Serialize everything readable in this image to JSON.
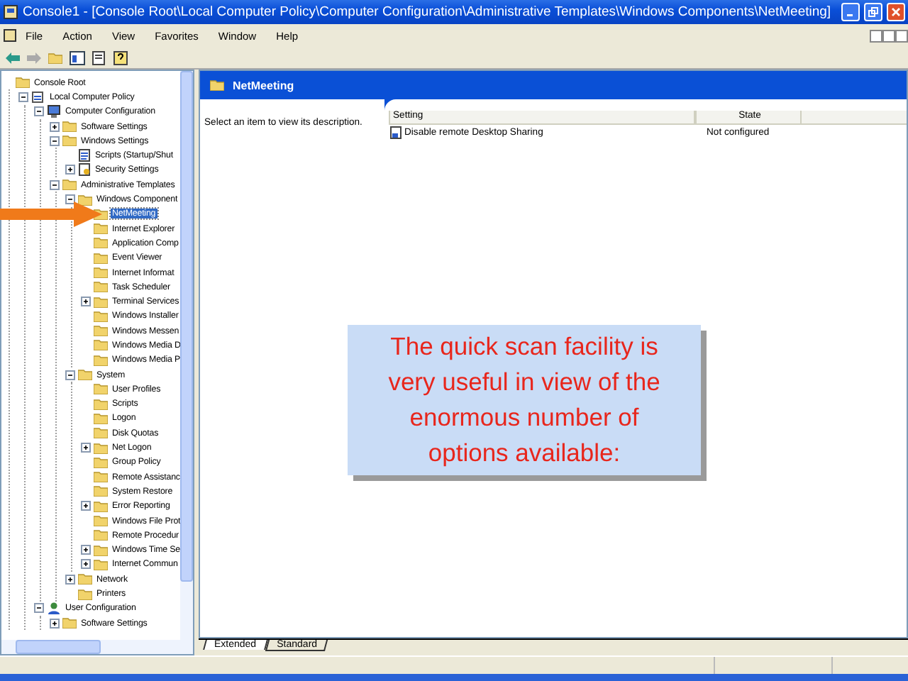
{
  "window": {
    "title": "Console1 - [Console Root\\Local Computer Policy\\Computer Configuration\\Administrative Templates\\Windows Components\\NetMeeting]"
  },
  "menu": [
    "File",
    "Action",
    "View",
    "Favorites",
    "Window",
    "Help"
  ],
  "tree": [
    {
      "label": "Console Root",
      "kind": "root",
      "selected": false,
      "children": [
        {
          "label": "Local Computer Policy",
          "kind": "policy",
          "expanded": true,
          "selected": false,
          "children": [
            {
              "label": "Computer Configuration",
              "kind": "computer",
              "expanded": true,
              "selected": false,
              "children": [
                {
                  "label": "Software Settings",
                  "kind": "folder",
                  "expanded": false,
                  "selected": false
                },
                {
                  "label": "Windows Settings",
                  "kind": "folder",
                  "expanded": true,
                  "selected": false,
                  "children": [
                    {
                      "label": "Scripts (Startup/Shut",
                      "kind": "scripts",
                      "selected": false
                    },
                    {
                      "label": "Security Settings",
                      "kind": "security",
                      "expanded": false,
                      "selected": false
                    }
                  ]
                },
                {
                  "label": "Administrative Templates",
                  "kind": "folder",
                  "expanded": true,
                  "selected": false,
                  "children": [
                    {
                      "label": "Windows Component",
                      "kind": "folder",
                      "expanded": true,
                      "selected": false,
                      "children": [
                        {
                          "label": "NetMeeting",
                          "kind": "folder",
                          "selected": true
                        },
                        {
                          "label": "Internet Explorer",
                          "kind": "folder",
                          "selected": false
                        },
                        {
                          "label": "Application Comp",
                          "kind": "folder",
                          "selected": false
                        },
                        {
                          "label": "Event Viewer",
                          "kind": "folder",
                          "selected": false
                        },
                        {
                          "label": "Internet Informat",
                          "kind": "folder",
                          "selected": false
                        },
                        {
                          "label": "Task Scheduler",
                          "kind": "folder",
                          "selected": false
                        },
                        {
                          "label": "Terminal Services",
                          "kind": "folder",
                          "expanded": false,
                          "selected": false
                        },
                        {
                          "label": "Windows Installer",
                          "kind": "folder",
                          "selected": false
                        },
                        {
                          "label": "Windows Messen",
                          "kind": "folder",
                          "selected": false
                        },
                        {
                          "label": "Windows Media D",
                          "kind": "folder",
                          "selected": false
                        },
                        {
                          "label": "Windows Media P",
                          "kind": "folder",
                          "selected": false
                        }
                      ]
                    },
                    {
                      "label": "System",
                      "kind": "folder",
                      "expanded": true,
                      "selected": false,
                      "children": [
                        {
                          "label": "User Profiles",
                          "kind": "folder",
                          "selected": false
                        },
                        {
                          "label": "Scripts",
                          "kind": "folder",
                          "selected": false
                        },
                        {
                          "label": "Logon",
                          "kind": "folder",
                          "selected": false
                        },
                        {
                          "label": "Disk Quotas",
                          "kind": "folder",
                          "selected": false
                        },
                        {
                          "label": "Net Logon",
                          "kind": "folder",
                          "expanded": false,
                          "selected": false
                        },
                        {
                          "label": "Group Policy",
                          "kind": "folder",
                          "selected": false
                        },
                        {
                          "label": "Remote Assistanc",
                          "kind": "folder",
                          "selected": false
                        },
                        {
                          "label": "System Restore",
                          "kind": "folder",
                          "selected": false
                        },
                        {
                          "label": "Error Reporting",
                          "kind": "folder",
                          "expanded": false,
                          "selected": false
                        },
                        {
                          "label": "Windows File Prot",
                          "kind": "folder",
                          "selected": false
                        },
                        {
                          "label": "Remote Procedur",
                          "kind": "folder",
                          "selected": false
                        },
                        {
                          "label": "Windows Time Se",
                          "kind": "folder",
                          "expanded": false,
                          "selected": false
                        },
                        {
                          "label": "Internet Commun",
                          "kind": "folder",
                          "expanded": false,
                          "selected": false
                        }
                      ]
                    },
                    {
                      "label": "Network",
                      "kind": "folder",
                      "expanded": false,
                      "selected": false
                    },
                    {
                      "label": "Printers",
                      "kind": "folder",
                      "selected": false
                    }
                  ]
                }
              ]
            },
            {
              "label": "User Configuration",
              "kind": "user",
              "expanded": true,
              "selected": false,
              "children": [
                {
                  "label": "Software Settings",
                  "kind": "folder",
                  "expanded": false,
                  "selected": false
                }
              ]
            }
          ]
        }
      ]
    }
  ],
  "details": {
    "title": "NetMeeting",
    "description": "Select an item to view its description.",
    "columns": [
      "Setting",
      "State"
    ],
    "rows": [
      {
        "setting": "Disable remote Desktop Sharing",
        "state": "Not configured"
      }
    ]
  },
  "view_tabs": [
    {
      "label": "Extended",
      "selected": true
    },
    {
      "label": "Standard",
      "selected": false
    }
  ],
  "callout": {
    "text": "The quick scan facility is very useful in view of the enormous number of options available:"
  }
}
